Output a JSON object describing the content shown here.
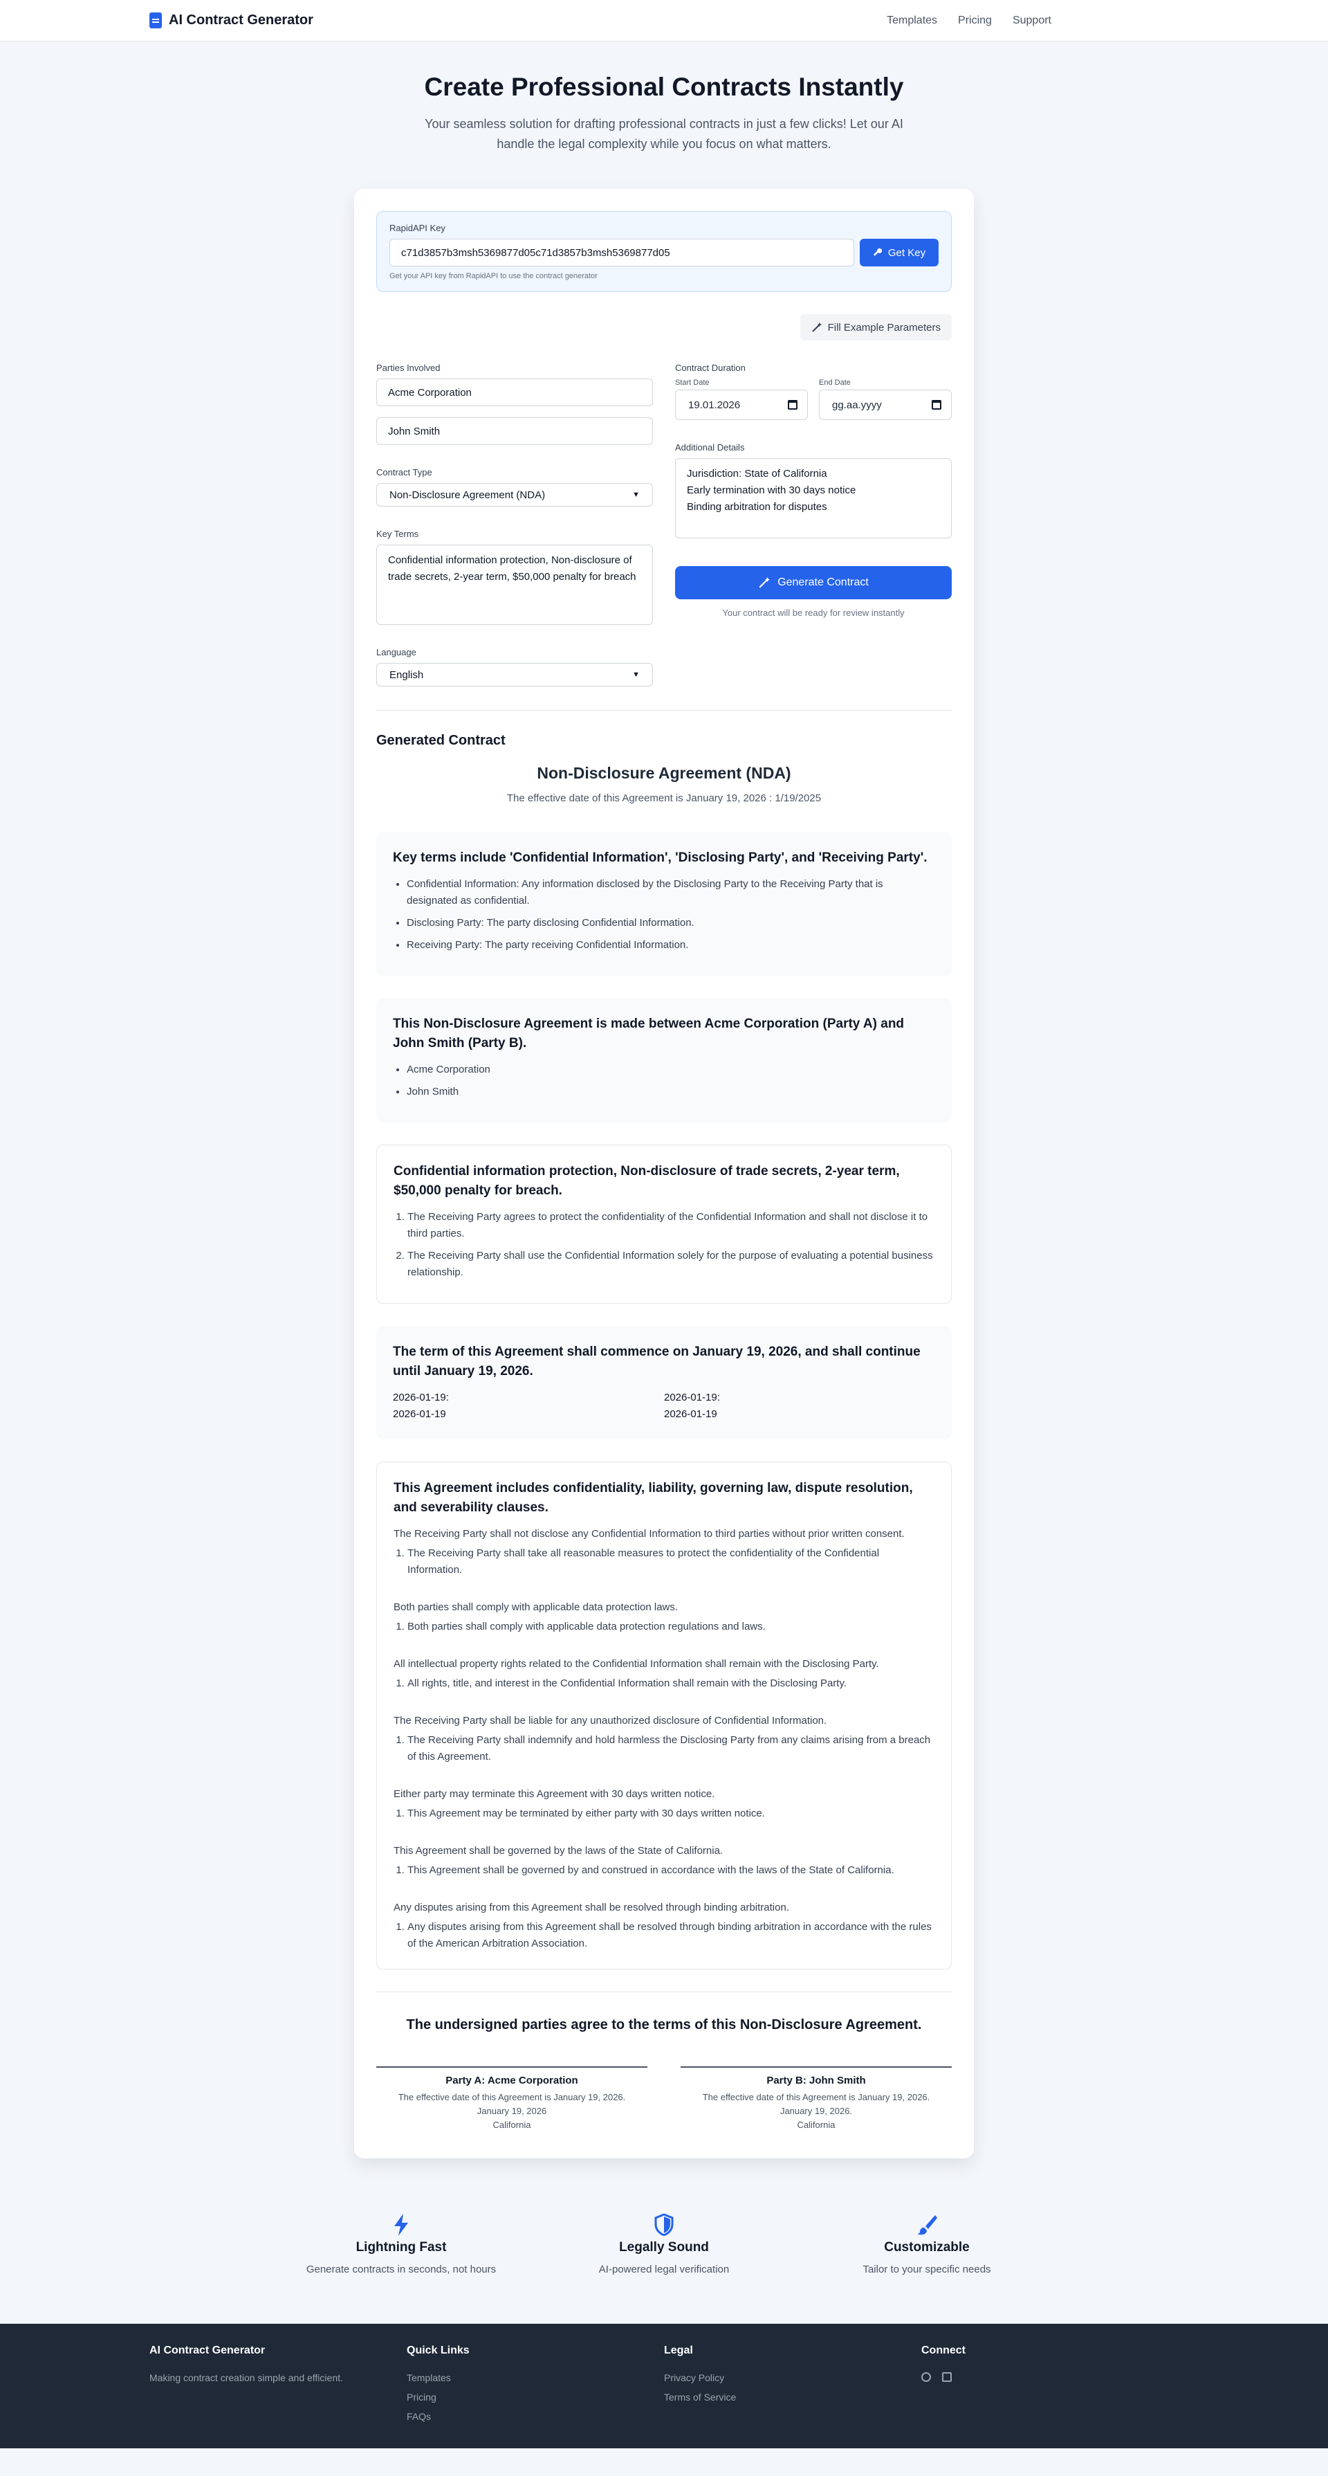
{
  "header": {
    "brand": "AI Contract Generator",
    "nav": [
      "Templates",
      "Pricing",
      "Support"
    ]
  },
  "hero": {
    "title": "Create Professional Contracts Instantly",
    "subtitle": "Your seamless solution for drafting professional contracts in just a few clicks! Let our AI handle the legal complexity while you focus on what matters."
  },
  "api": {
    "label": "RapidAPI Key",
    "value": "c71d3857b3msh5369877d05c71d3857b3msh5369877d05",
    "button": "Get Key",
    "hint": "Get your API key from RapidAPI to use the contract generator"
  },
  "fill_button": "Fill Example Parameters",
  "form": {
    "parties_label": "Parties Involved",
    "party_a": "Acme Corporation",
    "party_b": "John Smith",
    "contract_type_label": "Contract Type",
    "contract_type": "Non-Disclosure Agreement (NDA)",
    "key_terms_label": "Key Terms",
    "key_terms": "Confidential information protection, Non-disclosure of trade secrets, 2-year term, $50,000 penalty for breach",
    "language_label": "Language",
    "language": "English",
    "duration_label": "Contract Duration",
    "start_label": "Start Date",
    "start_value": "19.01.2026",
    "end_label": "End Date",
    "end_value": "gg.aa.yyyy",
    "additional_label": "Additional Details",
    "additional": "Jurisdiction: State of California\nEarly termination with 30 days notice\nBinding arbitration for disputes",
    "generate_button": "Generate Contract",
    "generate_note": "Your contract will be ready for review instantly"
  },
  "contract": {
    "heading": "Generated Contract",
    "title": "Non-Disclosure Agreement (NDA)",
    "effective": "The effective date of this Agreement is January 19, 2026 : 1/19/2025",
    "definitions": {
      "title": "Key terms include 'Confidential Information', 'Disclosing Party', and 'Receiving Party'.",
      "items": [
        "Confidential Information: Any information disclosed by the Disclosing Party to the Receiving Party that is designated as confidential.",
        "Disclosing Party: The party disclosing Confidential Information.",
        "Receiving Party: The party receiving Confidential Information."
      ]
    },
    "parties": {
      "title": "This Non-Disclosure Agreement is made between Acme Corporation (Party A) and John Smith (Party B).",
      "items": [
        "Acme Corporation",
        "John Smith"
      ]
    },
    "terms": {
      "title": "Confidential information protection, Non-disclosure of trade secrets, 2-year term, $50,000 penalty for breach.",
      "items": [
        "The Receiving Party agrees to protect the confidentiality of the Confidential Information and shall not disclose it to third parties.",
        "The Receiving Party shall use the Confidential Information solely for the purpose of evaluating a potential business relationship."
      ]
    },
    "duration": {
      "title": "The term of this Agreement shall commence on January 19, 2026, and shall continue until January 19, 2026.",
      "cells": [
        "2026-01-19:",
        "2026-01-19:",
        "2026-01-19",
        "2026-01-19"
      ]
    },
    "clauses": {
      "title": "This Agreement includes confidentiality, liability, governing law, dispute resolution, and severability clauses.",
      "items": [
        {
          "text": "The Receiving Party shall not disclose any Confidential Information to third parties without prior written consent.",
          "sub": "The Receiving Party shall take all reasonable measures to protect the confidentiality of the Confidential Information."
        },
        {
          "text": "Both parties shall comply with applicable data protection laws.",
          "sub": "Both parties shall comply with applicable data protection regulations and laws."
        },
        {
          "text": "All intellectual property rights related to the Confidential Information shall remain with the Disclosing Party.",
          "sub": "All rights, title, and interest in the Confidential Information shall remain with the Disclosing Party."
        },
        {
          "text": "The Receiving Party shall be liable for any unauthorized disclosure of Confidential Information.",
          "sub": "The Receiving Party shall indemnify and hold harmless the Disclosing Party from any claims arising from a breach of this Agreement."
        },
        {
          "text": "Either party may terminate this Agreement with 30 days written notice.",
          "sub": "This Agreement may be terminated by either party with 30 days written notice."
        },
        {
          "text": "This Agreement shall be governed by the laws of the State of California.",
          "sub": "This Agreement shall be governed by and construed in accordance with the laws of the State of California."
        },
        {
          "text": "Any disputes arising from this Agreement shall be resolved through binding arbitration.",
          "sub": "Any disputes arising from this Agreement shall be resolved through binding arbitration in accordance with the rules of the American Arbitration Association."
        }
      ]
    },
    "agree": "The undersigned parties agree to the terms of this Non-Disclosure Agreement.",
    "sig_a": {
      "name": "Party A: Acme Corporation",
      "l1": "The effective date of this Agreement is January 19, 2026.",
      "l2": "January 19, 2026",
      "l3": "California"
    },
    "sig_b": {
      "name": "Party B: John Smith",
      "l1": "The effective date of this Agreement is January 19, 2026.",
      "l2": "January 19, 2026.",
      "l3": "California"
    }
  },
  "features": [
    {
      "title": "Lightning Fast",
      "text": "Generate contracts in seconds, not hours",
      "icon": "bolt-icon"
    },
    {
      "title": "Legally Sound",
      "text": "AI-powered legal verification",
      "icon": "shield-icon"
    },
    {
      "title": "Customizable",
      "text": "Tailor to your specific needs",
      "icon": "brush-icon"
    }
  ],
  "footer": {
    "brand": "AI Contract Generator",
    "tagline": "Making contract creation simple and efficient.",
    "quick_title": "Quick Links",
    "quick": [
      "Templates",
      "Pricing",
      "FAQs"
    ],
    "legal_title": "Legal",
    "legal": [
      "Privacy Policy",
      "Terms of Service"
    ],
    "connect_title": "Connect"
  },
  "colors": {
    "primary": "#2563eb",
    "footer": "#1f2937",
    "page": "#f3f6fb"
  }
}
